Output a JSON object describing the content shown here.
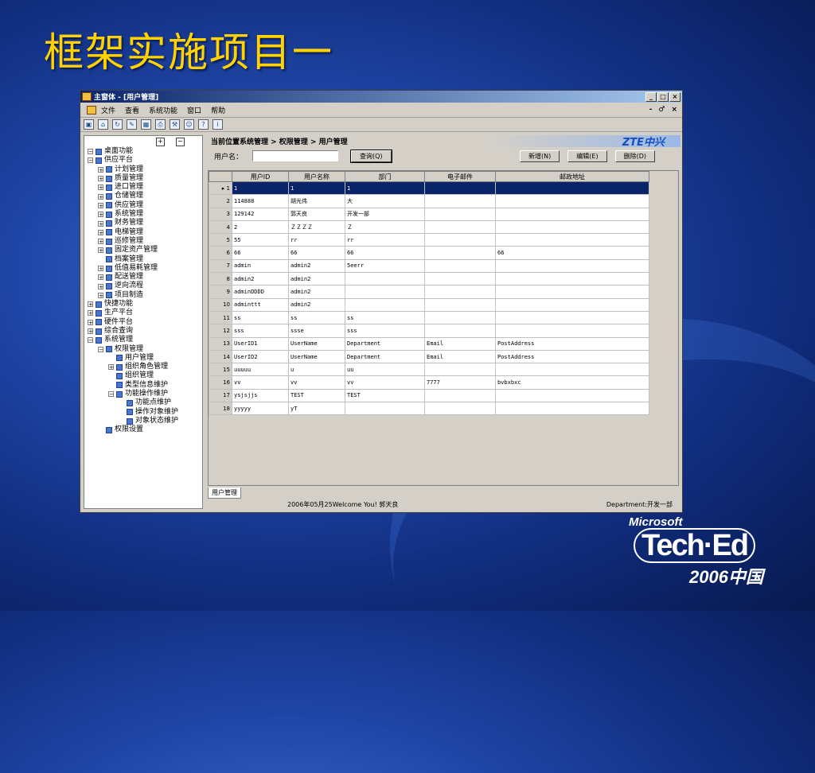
{
  "slide": {
    "title": "框架实施项目一"
  },
  "window": {
    "title": "主窗体 - [用户管理]",
    "title_buttons": [
      "_",
      "□",
      "×"
    ],
    "menu": [
      "文件",
      "查看",
      "系统功能",
      "窗口",
      "帮助"
    ],
    "mdi_controls": [
      "-",
      "♂",
      "×"
    ]
  },
  "toolbar": {
    "icons": [
      "window-icon",
      "home-icon",
      "refresh-icon",
      "edit-icon",
      "image-icon",
      "print-icon",
      "tool-icon",
      "user-icon",
      "help-icon",
      "info-icon"
    ]
  },
  "tree": {
    "items": [
      {
        "label": "桌面功能",
        "depth": 0,
        "exp": "−"
      },
      {
        "label": "供应平台",
        "depth": 0,
        "exp": "−"
      },
      {
        "label": "计划管理",
        "depth": 1,
        "exp": "+"
      },
      {
        "label": "质量管理",
        "depth": 1,
        "exp": "+"
      },
      {
        "label": "进口管理",
        "depth": 1,
        "exp": "+"
      },
      {
        "label": "仓储管理",
        "depth": 1,
        "exp": "+"
      },
      {
        "label": "供应管理",
        "depth": 1,
        "exp": "+"
      },
      {
        "label": "系统管理",
        "depth": 1,
        "exp": "+"
      },
      {
        "label": "财务管理",
        "depth": 1,
        "exp": "+"
      },
      {
        "label": "电梯管理",
        "depth": 1,
        "exp": "+"
      },
      {
        "label": "巡修管理",
        "depth": 1,
        "exp": "+"
      },
      {
        "label": "固定资产管理",
        "depth": 1,
        "exp": "+"
      },
      {
        "label": "档案管理",
        "depth": 1,
        "exp": ""
      },
      {
        "label": "低值易耗管理",
        "depth": 1,
        "exp": "+"
      },
      {
        "label": "配送管理",
        "depth": 1,
        "exp": "+"
      },
      {
        "label": "逆向流程",
        "depth": 1,
        "exp": "+"
      },
      {
        "label": "项目制造",
        "depth": 1,
        "exp": "+"
      },
      {
        "label": "快捷功能",
        "depth": 0,
        "exp": "+"
      },
      {
        "label": "生产平台",
        "depth": 0,
        "exp": "+"
      },
      {
        "label": "硬件平台",
        "depth": 0,
        "exp": "+"
      },
      {
        "label": "综合查询",
        "depth": 0,
        "exp": "+"
      },
      {
        "label": "系统管理",
        "depth": 0,
        "exp": "−"
      },
      {
        "label": "权限管理",
        "depth": 1,
        "exp": "−"
      },
      {
        "label": "用户管理",
        "depth": 2,
        "exp": ""
      },
      {
        "label": "组织角色管理",
        "depth": 2,
        "exp": "+"
      },
      {
        "label": "组织管理",
        "depth": 2,
        "exp": ""
      },
      {
        "label": "类型信息维护",
        "depth": 2,
        "exp": ""
      },
      {
        "label": "功能操作维护",
        "depth": 2,
        "exp": "−"
      },
      {
        "label": "功能点维护",
        "depth": 3,
        "exp": ""
      },
      {
        "label": "操作对象维护",
        "depth": 3,
        "exp": ""
      },
      {
        "label": "对象状态维护",
        "depth": 3,
        "exp": ""
      },
      {
        "label": "权限设置",
        "depth": 1,
        "exp": ""
      }
    ]
  },
  "breadcrumb": {
    "text": "当前位置系统管理 > 权限管理 > 用户管理",
    "logo": "ZTE中兴"
  },
  "search": {
    "label": "用户名：",
    "value": "",
    "query_button": "查询(Q)"
  },
  "actions": {
    "add": "新增(N)",
    "edit": "编辑(E)",
    "delete": "删除(D)"
  },
  "grid": {
    "columns": [
      "用户ID",
      "用户名称",
      "部门",
      "电子邮件",
      "邮政地址"
    ],
    "rows": [
      [
        "1",
        "1",
        "1",
        "",
        ""
      ],
      [
        "114888",
        "胡光伟",
        "大",
        "",
        ""
      ],
      [
        "129142",
        "郭天良",
        "开发一部",
        "",
        ""
      ],
      [
        "2",
        "ＺＺＺＺ",
        "Ｚ",
        "",
        ""
      ],
      [
        "55",
        "rr",
        "rr",
        "",
        ""
      ],
      [
        "66",
        "66",
        "66",
        "",
        "66"
      ],
      [
        "admin",
        "admin2",
        "5eerr",
        "",
        ""
      ],
      [
        "admin2",
        "admin2",
        "",
        "",
        ""
      ],
      [
        "adminDDDD",
        "admin2",
        "",
        "",
        ""
      ],
      [
        "adminttt",
        "admin2",
        "",
        "",
        ""
      ],
      [
        "ss",
        "ss",
        "ss",
        "",
        ""
      ],
      [
        "sss",
        "ssse",
        "sss",
        "",
        ""
      ],
      [
        "UserID1",
        "UserName",
        "Department",
        "Email",
        "PostAddress"
      ],
      [
        "UserID2",
        "UserName",
        "Department",
        "Email",
        "PostAddress"
      ],
      [
        "uuuuu",
        "u",
        "uu",
        "",
        ""
      ],
      [
        "vv",
        "vv",
        "vv",
        "7777",
        "bvbxbxc"
      ],
      [
        "ysjsjjs",
        "TEST",
        "TEST",
        "",
        ""
      ],
      [
        "yyyyy",
        "yT",
        "",
        "",
        ""
      ]
    ],
    "selected_row": 0
  },
  "tab": {
    "label": "用户管理"
  },
  "status": {
    "left": "2006年05月25Welcome You! 郭天良",
    "right": "Department:开发一部"
  },
  "logo": {
    "microsoft": "Microsoft",
    "teched": "Tech·Ed",
    "year": "2006中国"
  }
}
